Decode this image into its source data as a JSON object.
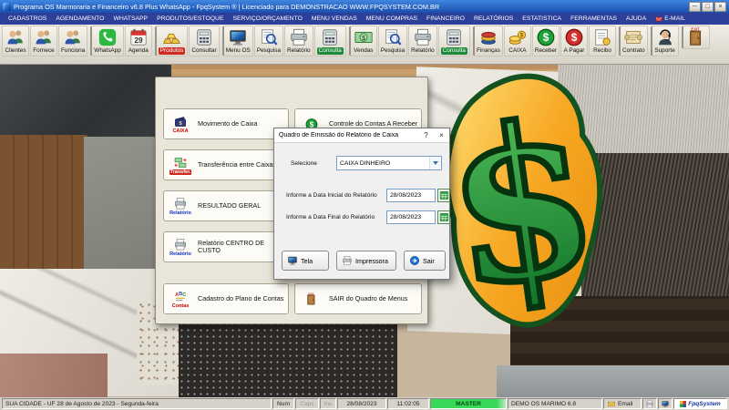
{
  "window": {
    "title": "Programa OS Marmoraria e Financeiro v6.8 Plus WhatsApp - FpqSystem ® | Licenciado para  DEMONSTRACAO WWW.FPQSYSTEM.COM.BR",
    "minimize": "─",
    "maximize": "□",
    "close": "×"
  },
  "menubar": {
    "items": [
      {
        "name": "menu-cadastros",
        "label": "CADASTROS"
      },
      {
        "name": "menu-agendamento",
        "label": "AGENDAMENTO"
      },
      {
        "name": "menu-whatsapp",
        "label": "WHATSAPP"
      },
      {
        "name": "menu-produtos-estoque",
        "label": "PRODUTOS/ESTOQUE"
      },
      {
        "name": "menu-servico-orcamento",
        "label": "SERVIÇO/ORÇAMENTO"
      },
      {
        "name": "menu-menu-vendas",
        "label": "MENU VENDAS"
      },
      {
        "name": "menu-menu-compras",
        "label": "MENU COMPRAS"
      },
      {
        "name": "menu-financeiro",
        "label": "FINANCEIRO"
      },
      {
        "name": "menu-relatorios",
        "label": "RELATÓRIOS"
      },
      {
        "name": "menu-estatistica",
        "label": "ESTATISTICA"
      },
      {
        "name": "menu-ferramentas",
        "label": "FERRAMENTAS"
      },
      {
        "name": "menu-ajuda",
        "label": "AJUDA"
      },
      {
        "name": "menu-email",
        "label": "E-MAIL",
        "icon": "i-envelope-red"
      }
    ]
  },
  "toolbar": {
    "items": [
      {
        "name": "toolbar-clientes",
        "label": "Clientes",
        "icon": "i-people"
      },
      {
        "name": "toolbar-fornecedores",
        "label": "Fornece",
        "icon": "i-people"
      },
      {
        "name": "toolbar-funcionarios",
        "label": "Funciona",
        "icon": "i-people"
      },
      {
        "name": "toolbar-whatsapp",
        "label": "WhatsApp",
        "icon": "i-whatsapp",
        "grp": "grp-sep"
      },
      {
        "name": "toolbar-agenda",
        "label": "Agenda",
        "icon": "i-agenda"
      },
      {
        "name": "toolbar-produtos",
        "label": "Produtos",
        "icon": "i-goldbars",
        "chip": "chip-red",
        "grp": "grp-sep"
      },
      {
        "name": "toolbar-consultar",
        "label": "Consultar",
        "icon": "i-calc"
      },
      {
        "name": "toolbar-menu-os",
        "label": "Menu OS",
        "icon": "i-monitor",
        "grp": "grp-sep"
      },
      {
        "name": "toolbar-pesquisa-os",
        "label": "Pesquisa",
        "icon": "i-search"
      },
      {
        "name": "toolbar-relatorio-os",
        "label": "Relatório",
        "icon": "i-printer"
      },
      {
        "name": "toolbar-consulta-os",
        "label": "Consulta",
        "icon": "i-calc",
        "chip": "chip-green"
      },
      {
        "name": "toolbar-vendas",
        "label": "Vendas",
        "icon": "i-money",
        "grp": "grp-sep"
      },
      {
        "name": "toolbar-pesquisa-vendas",
        "label": "Pesquisa",
        "icon": "i-search"
      },
      {
        "name": "toolbar-relatorio-vendas",
        "label": "Relatório",
        "icon": "i-printer"
      },
      {
        "name": "toolbar-consulta-vendas",
        "label": "Consulta",
        "icon": "i-calc",
        "chip": "chip-green"
      },
      {
        "name": "toolbar-financas",
        "label": "Finanças",
        "icon": "i-disks",
        "grp": "grp-sep"
      },
      {
        "name": "toolbar-caixa",
        "label": "CAIXA",
        "icon": "i-coins"
      },
      {
        "name": "toolbar-receber",
        "label": "Receber",
        "icon": "i-dollar-green"
      },
      {
        "name": "toolbar-a-pagar",
        "label": "A Pagar",
        "icon": "i-dollar-red"
      },
      {
        "name": "toolbar-recibo",
        "label": "Recibo",
        "icon": "i-receipt"
      },
      {
        "name": "toolbar-contrato",
        "label": "Contrato",
        "icon": "i-scroll",
        "grp": "grp-sep"
      },
      {
        "name": "toolbar-suporte",
        "label": "Suporte",
        "icon": "i-support",
        "grp": "grp-sep"
      },
      {
        "name": "toolbar-sair",
        "label": "",
        "icon": "i-door",
        "grp": "grp-sep"
      }
    ]
  },
  "menu_panel": {
    "left": [
      {
        "name": "panel-movimento-caixa",
        "label": "Movimento de Caixa",
        "icon": "i-wallet",
        "caption": "CAIXA",
        "capcls": "cap-red"
      },
      {
        "name": "panel-transferencia-caixas",
        "label": "Transferência entre Caixas",
        "icon": "i-transfer",
        "caption": "Transfer.",
        "capcls": "cap-chip"
      },
      {
        "name": "panel-resultado-geral",
        "label": "RESULTADO GERAL",
        "icon": "i-printer",
        "caption": "Relatório",
        "capcls": "cap-blue"
      },
      {
        "name": "panel-relatorio-centro-custo",
        "label": "Relatório CENTRO DE CUSTO",
        "icon": "i-printer",
        "caption": "Relatório",
        "capcls": "cap-blue"
      },
      {
        "name": "panel-cadastro-plano-contas",
        "label": "Cadastro do Plano de Contas",
        "icon": "i-abc",
        "caption": "Contas",
        "capcls": "cap-red"
      }
    ],
    "right": [
      {
        "name": "panel-contas-a-receber",
        "label": "Controle do Contas A Receber",
        "icon": "i-dollar-green"
      },
      {
        "name": "panel-sair-quadro-menus",
        "label": "SAIR do Quadro de Menus",
        "icon": "i-door"
      }
    ]
  },
  "dialog": {
    "title": "Quadro de Emissão do Relatório de Caixa",
    "help": "?",
    "close": "×",
    "select_label": "Selecione",
    "combo_value": "CAIXA DINHEIRO",
    "date_start_label": "Informe a Data Inicial do Relatório",
    "date_start_value": "28/08/2023",
    "date_end_label": "Informe a Data Final do Relatório",
    "date_end_value": "28/08/2023",
    "buttons": [
      {
        "name": "dialog-tela-button",
        "label": "Tela",
        "icon": "i-monitor"
      },
      {
        "name": "dialog-impressora-button",
        "label": "Impressora",
        "icon": "i-printer"
      },
      {
        "name": "dialog-sair-button",
        "label": "Sair",
        "icon": "i-arrow-blue"
      }
    ]
  },
  "statusbar": {
    "location": "SUA CIDADE - UF 28 de Agosto de 2023 - Segunda-feira",
    "num": "Num",
    "caps": "Caps",
    "ins": "Ins",
    "date": "28/08/2023",
    "time": "11:02:05",
    "user": "MASTER",
    "app": "DEMO OS MARIMO 6.8",
    "email": "Email",
    "logo": "FpqSystem"
  },
  "colors": {
    "titlebar_blue": "#1a4fae",
    "menubar_navy": "#2c3f99",
    "chip_red": "#cf2a22",
    "chip_green": "#1d8a3a",
    "master_green": "#37d857",
    "panel_beige": "#e9e5d8"
  }
}
